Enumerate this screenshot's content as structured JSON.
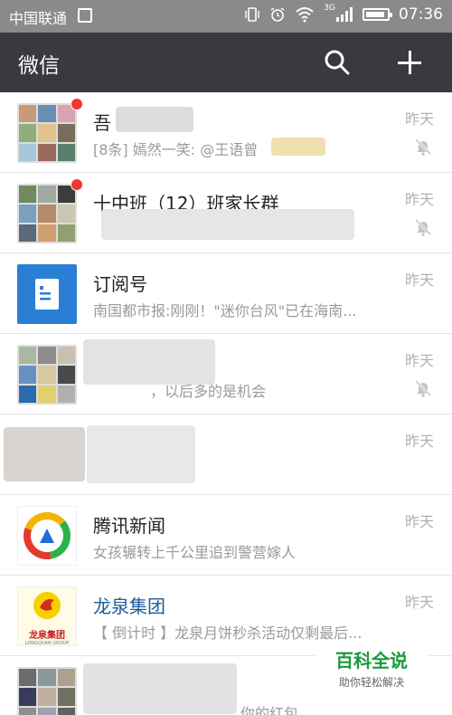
{
  "status_bar": {
    "carrier": "中国联通",
    "network": "3G",
    "time": "07:36"
  },
  "app_bar": {
    "title": "微信",
    "search_icon": "search-icon",
    "add_icon": "plus-icon"
  },
  "chats": [
    {
      "name": "吾",
      "preview": "[8条] 嫣然一笑: @王语曾",
      "time": "昨天",
      "unread": true,
      "muted": true
    },
    {
      "name": "十中班（12）班家长群",
      "preview": "",
      "time": "昨天",
      "unread": true,
      "muted": true
    },
    {
      "name": "订阅号",
      "preview": "南国都市报:刚刚！\"迷你台风\"已在海南...",
      "time": "昨天",
      "unread": false,
      "muted": false
    },
    {
      "name": "",
      "preview": "，以后多的是机会",
      "time": "昨天",
      "unread": false,
      "muted": true
    },
    {
      "name": "",
      "preview": "",
      "time": "昨天",
      "unread": false,
      "muted": false
    },
    {
      "name": "腾讯新闻",
      "preview": "女孩辗转上千公里追到警营嫁人",
      "time": "昨天",
      "unread": false,
      "muted": false
    },
    {
      "name": "龙泉集团",
      "preview": "【 倒计时 】龙泉月饼秒杀活动仅剩最后...",
      "time": "昨天",
      "unread": false,
      "muted": false,
      "logo_text": "龙泉集团",
      "logo_sub": "LONGQUAN GROUP"
    },
    {
      "name": "",
      "preview": "你的红包",
      "time": "",
      "unread": false,
      "muted": false
    }
  ],
  "watermark": {
    "title": "百科全说",
    "subtitle": "助你轻松解决"
  },
  "colors": {
    "status_bar": "#8a8a8a",
    "app_bar": "#393a3f",
    "unread_dot": "#f43530",
    "subscription_blue": "#2a7fd4"
  }
}
